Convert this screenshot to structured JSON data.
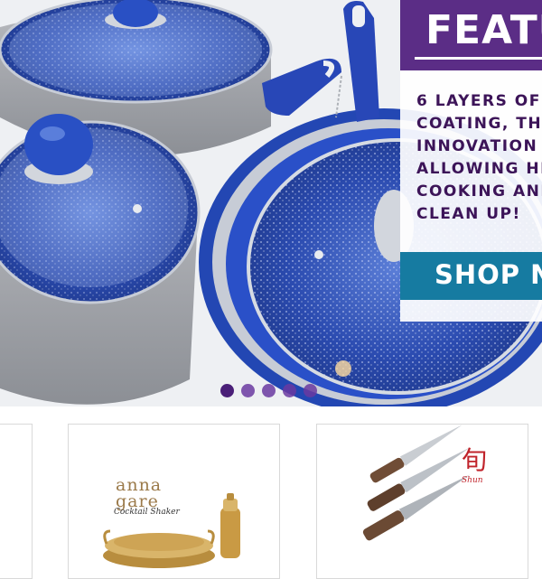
{
  "hero": {
    "image": "blue speckled non-stick cookware set with glass lids",
    "feature": {
      "title": "FEATU",
      "lines": [
        "6 LAYERS OF",
        "COATING, THIS",
        "INNOVATION I",
        "ALLOWING HEA",
        "COOKING AND",
        "CLEAN UP!"
      ],
      "button_label": "SHOP N"
    },
    "slides": {
      "count": 5,
      "active": 1
    }
  },
  "products": [
    {
      "name": "partial-product-card"
    },
    {
      "name": "anna-gare-card",
      "brand_lines": [
        "anna",
        "gare"
      ],
      "brand_sub": "Cocktail Shaker"
    },
    {
      "name": "shun-knives-card",
      "logo_glyph": "旬",
      "logo_sub": "Shun"
    }
  ],
  "colors": {
    "purple": "#5b2d86",
    "dark_purple_text": "#3c1458",
    "teal_button": "#167ba1",
    "cookware_blue": "#2a50c8",
    "gold": "#c9a45a",
    "shun_red": "#c0232b"
  }
}
